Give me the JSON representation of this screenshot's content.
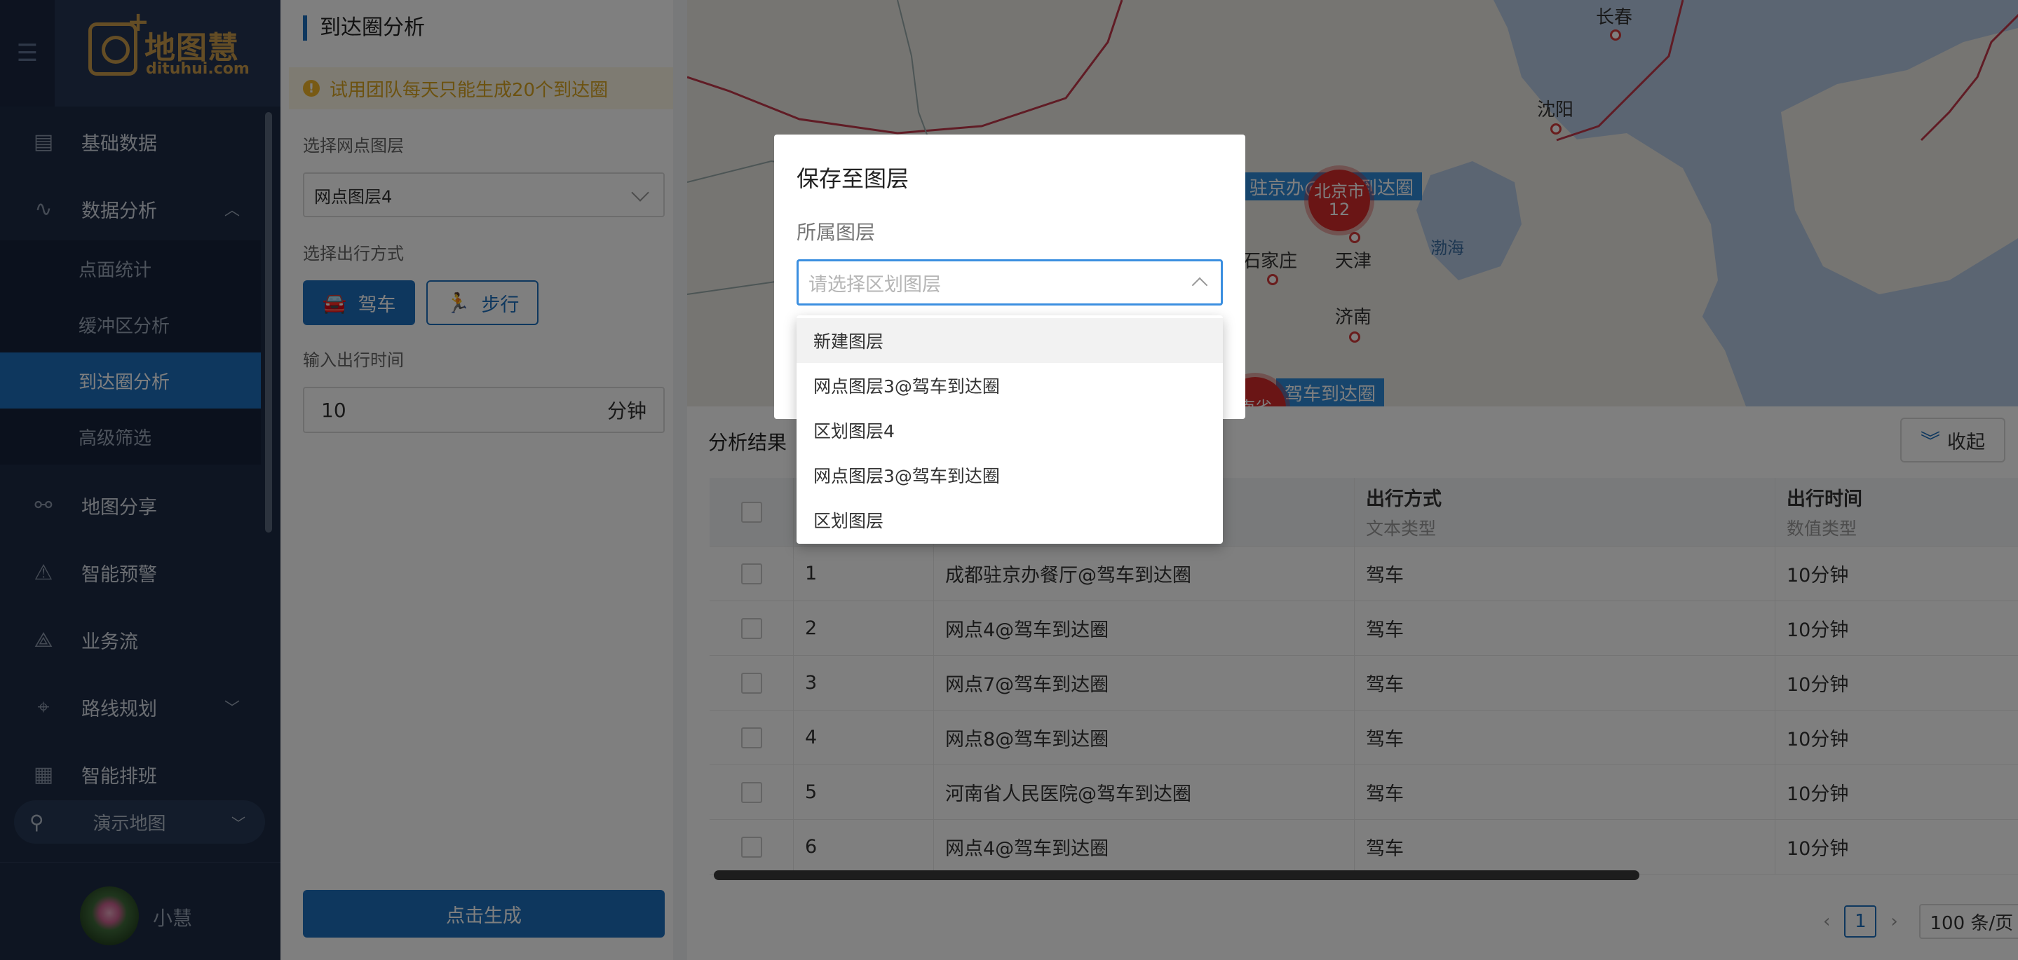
{
  "sidebar": {
    "brand": {
      "name": "地图慧",
      "domain": "dituhui.com"
    },
    "items": [
      {
        "label": "基础数据",
        "icon": "database-icon"
      },
      {
        "label": "数据分析",
        "icon": "analysis-icon",
        "expanded": true
      },
      {
        "label": "地图分享",
        "icon": "share-icon"
      },
      {
        "label": "智能预警",
        "icon": "alert-icon"
      },
      {
        "label": "业务流",
        "icon": "workflow-icon"
      },
      {
        "label": "路线规划",
        "icon": "route-icon"
      },
      {
        "label": "智能排班",
        "icon": "calendar-icon"
      }
    ],
    "sub_items": [
      {
        "label": "点面统计"
      },
      {
        "label": "缓冲区分析"
      },
      {
        "label": "到达圈分析",
        "active": true
      },
      {
        "label": "高级筛选"
      }
    ],
    "demo_map": "演示地图",
    "user_name": "小慧"
  },
  "panel": {
    "title": "到达圈分析",
    "notice": "试用团队每天只能生成20个到达圈",
    "layer_label": "选择网点图层",
    "layer_value": "网点图层4",
    "mode_label": "选择出行方式",
    "mode_drive": "驾车",
    "mode_walk": "步行",
    "time_label": "输入出行时间",
    "time_value": "10",
    "time_unit": "分钟",
    "generate": "点击生成"
  },
  "map": {
    "cities": [
      "长春",
      "沈阳",
      "石家庄",
      "天津",
      "济南"
    ],
    "sea": "渤海",
    "cluster": {
      "name": "北京市",
      "count": "12"
    },
    "tags": [
      "驻京办@驾车到达圈",
      "驾车到达圈"
    ],
    "partial": "南省"
  },
  "results": {
    "title": "分析结果",
    "collapse": "收起",
    "columns": [
      {
        "label": "",
        "type": ""
      },
      {
        "label": "",
        "type": ""
      },
      {
        "label": "",
        "type": ""
      },
      {
        "label": "出行方式",
        "type": "文本类型"
      },
      {
        "label": "出行时间",
        "type": "数值类型"
      }
    ],
    "rows": [
      {
        "id": "1",
        "name": "成都驻京办餐厅@驾车到达圈",
        "mode": "驾车",
        "time": "10分钟"
      },
      {
        "id": "2",
        "name": "网点4@驾车到达圈",
        "mode": "驾车",
        "time": "10分钟"
      },
      {
        "id": "3",
        "name": "网点7@驾车到达圈",
        "mode": "驾车",
        "time": "10分钟"
      },
      {
        "id": "4",
        "name": "网点8@驾车到达圈",
        "mode": "驾车",
        "time": "10分钟"
      },
      {
        "id": "5",
        "name": "河南省人民医院@驾车到达圈",
        "mode": "驾车",
        "time": "10分钟"
      },
      {
        "id": "6",
        "name": "网点4@驾车到达圈",
        "mode": "驾车",
        "time": "10分钟"
      }
    ],
    "pager": {
      "page": "1",
      "page_size": "100 条/页"
    }
  },
  "modal": {
    "title": "保存至图层",
    "label": "所属图层",
    "placeholder": "请选择区划图层",
    "options": [
      "新建图层",
      "网点图层3@驾车到达圈",
      "区划图层4",
      "网点图层3@驾车到达圈",
      "区划图层"
    ]
  }
}
